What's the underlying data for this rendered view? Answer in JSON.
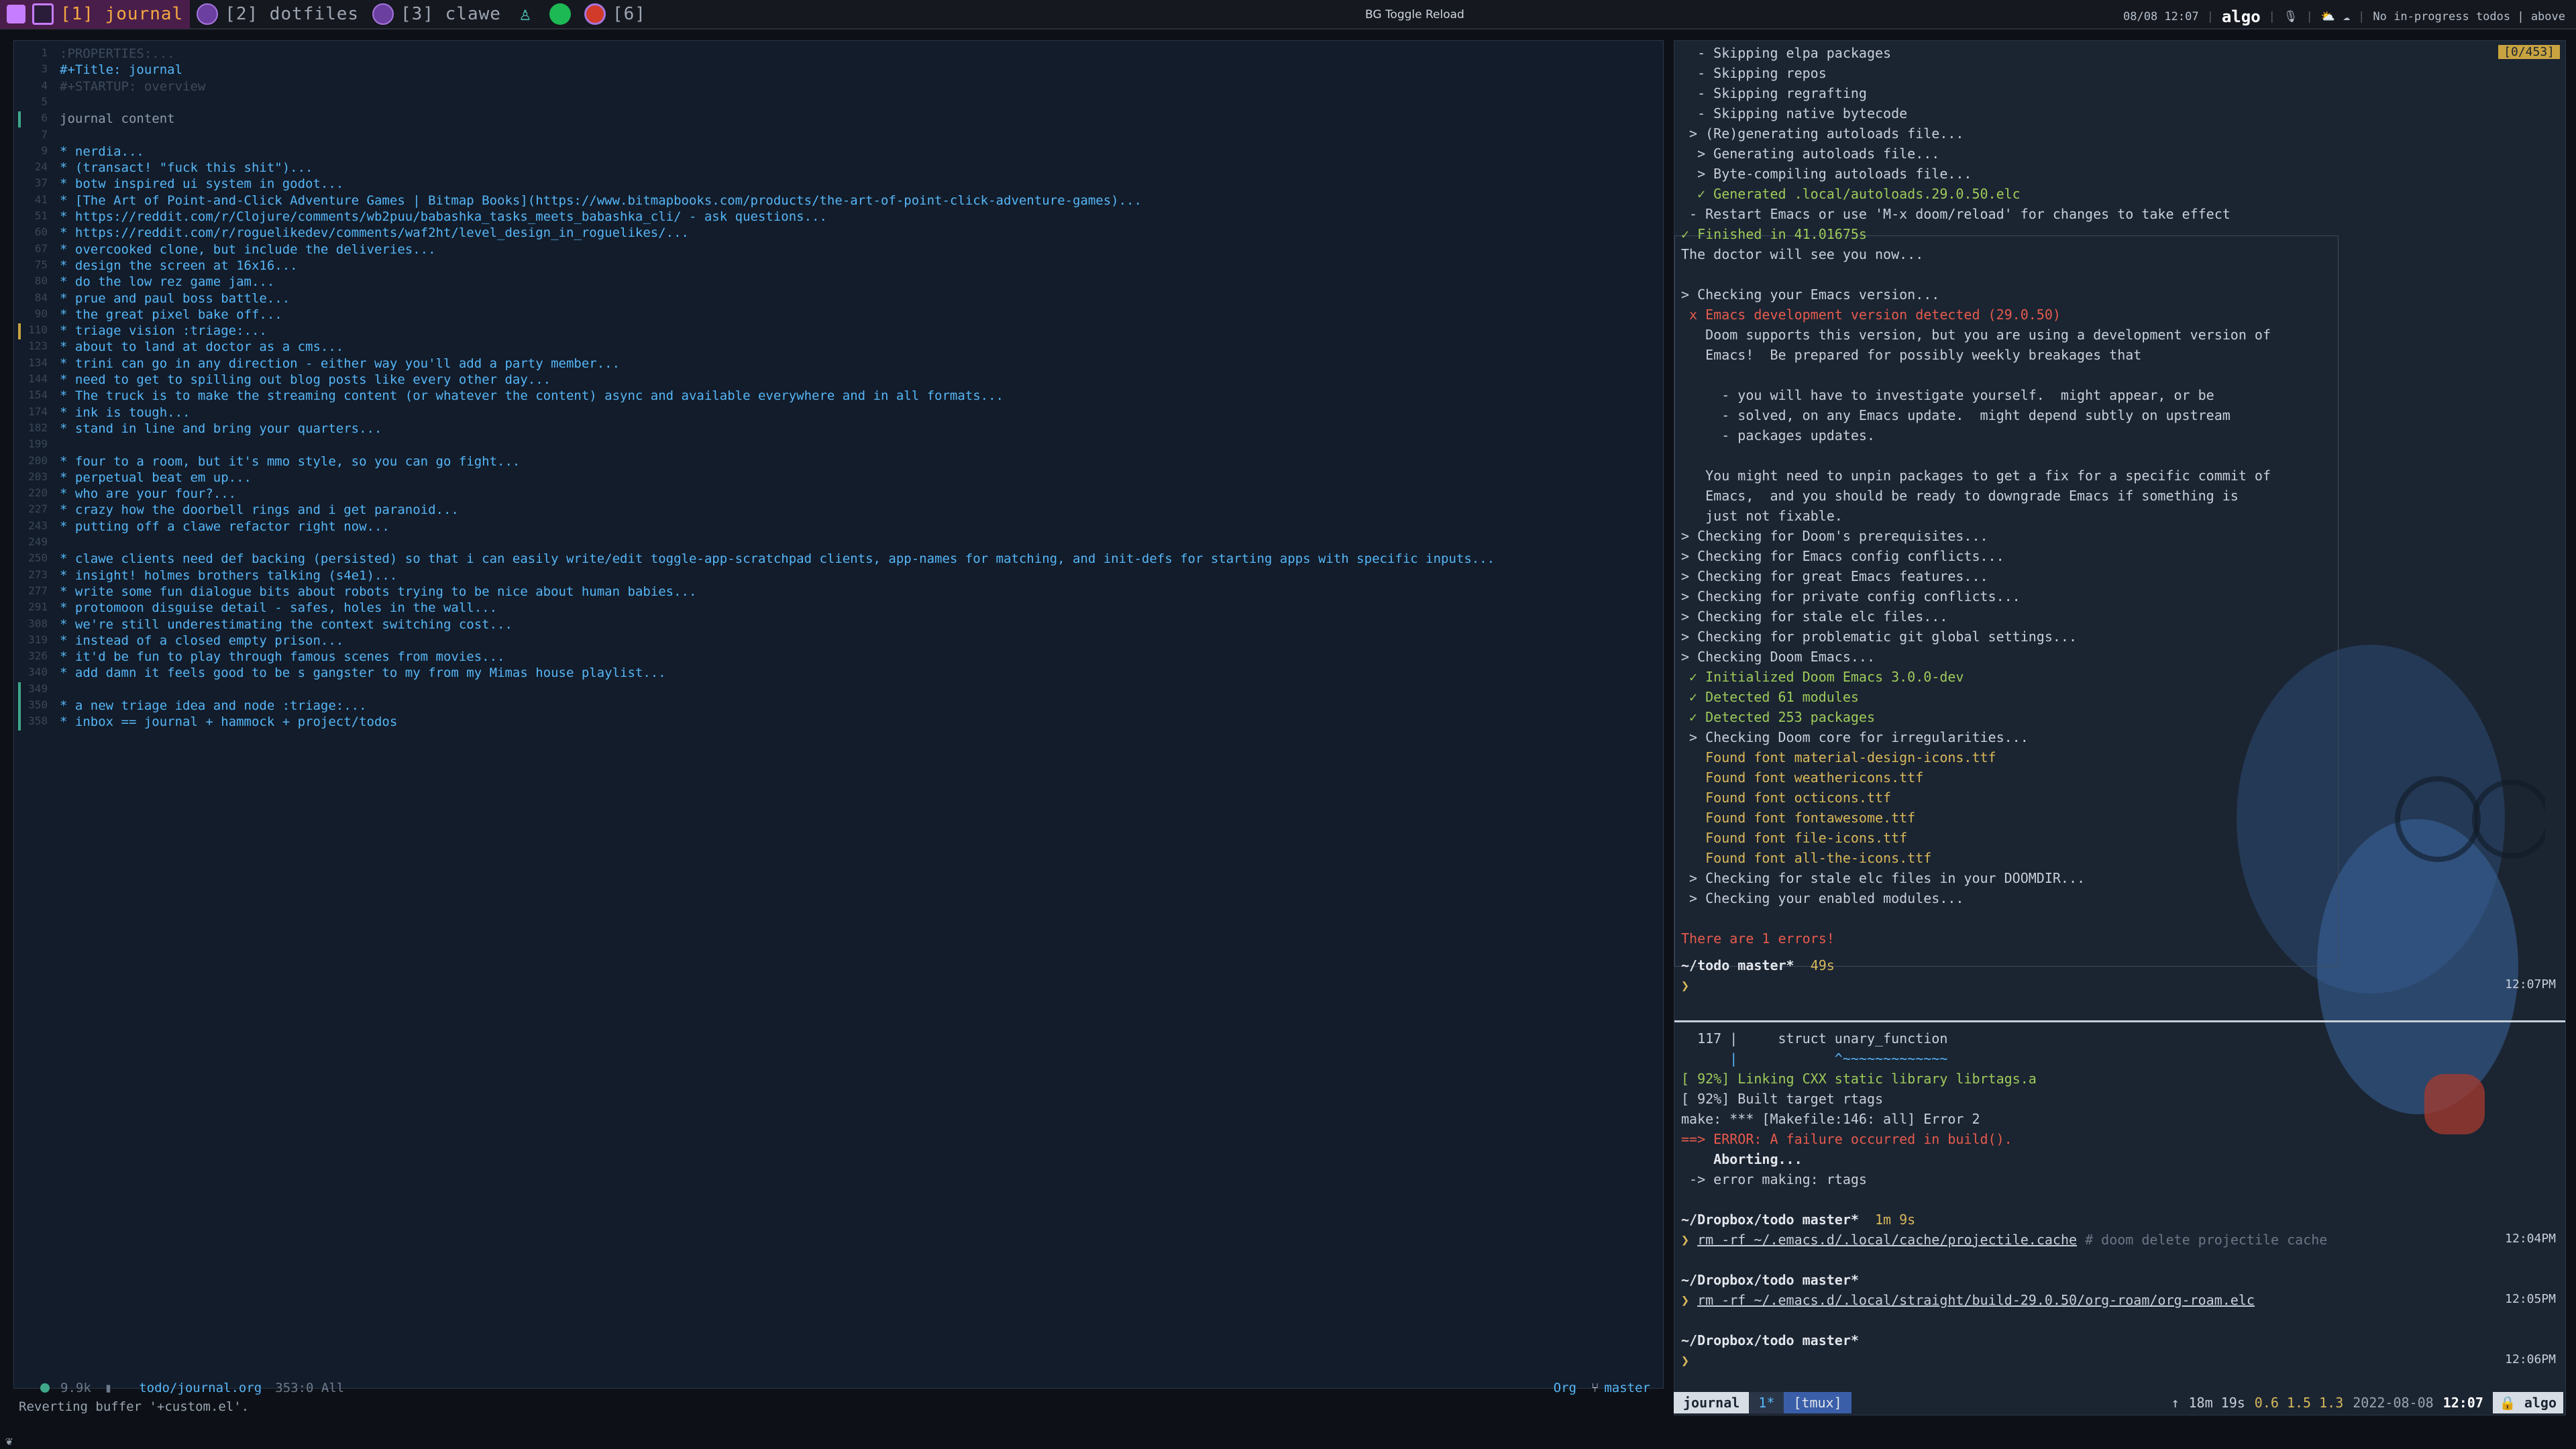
{
  "topbar": {
    "workspaces": [
      {
        "label": "[1] journal",
        "icon": "check-icon",
        "active": true
      },
      {
        "label": "[2] dotfiles",
        "icon": "emacs-icon",
        "active": false
      },
      {
        "label": "[3] clawe",
        "icon": "emacs-icon",
        "active": false
      },
      {
        "label": "",
        "icon": "person-icon",
        "active": false
      },
      {
        "label": "",
        "icon": "spotify-icon",
        "active": false
      },
      {
        "label": "[6]",
        "icon": "firefox-icon",
        "active": false
      }
    ],
    "center_label": "BG Toggle Reload",
    "status": {
      "datetime": "08/08 12:07",
      "host": "algo",
      "todos": "No in-progress todos | above"
    }
  },
  "editor": {
    "lines": [
      {
        "n": "1",
        "t": ":PROPERTIES:...",
        "cls": "dim"
      },
      {
        "n": "3",
        "t": "#+Title: journal",
        "cls": "title"
      },
      {
        "n": "4",
        "t": "#+STARTUP: overview",
        "cls": "dim"
      },
      {
        "n": "5",
        "t": "",
        "cls": "dim"
      },
      {
        "n": "6",
        "t": "journal content",
        "cls": "plain",
        "gutter": "g"
      },
      {
        "n": "7",
        "t": "",
        "cls": "dim"
      },
      {
        "n": "9",
        "t": "* nerdia...",
        "cls": "h"
      },
      {
        "n": "24",
        "t": "* (transact! \"fuck this shit\")...",
        "cls": "h"
      },
      {
        "n": "37",
        "t": "* botw inspired ui system in godot...",
        "cls": "h"
      },
      {
        "n": "41",
        "t": "* [The Art of Point-and-Click Adventure Games | Bitmap Books](https://www.bitmapbooks.com/products/the-art-of-point-click-adventure-games)...",
        "cls": "h"
      },
      {
        "n": "51",
        "t": "* https://reddit.com/r/Clojure/comments/wb2puu/babashka_tasks_meets_babashka_cli/ - ask questions...",
        "cls": "h"
      },
      {
        "n": "60",
        "t": "* https://reddit.com/r/roguelikedev/comments/waf2ht/level_design_in_roguelikes/...",
        "cls": "h"
      },
      {
        "n": "67",
        "t": "* overcooked clone, but include the deliveries...",
        "cls": "h"
      },
      {
        "n": "75",
        "t": "* design the screen at 16x16...",
        "cls": "h"
      },
      {
        "n": "80",
        "t": "* do the low rez game jam...",
        "cls": "h"
      },
      {
        "n": "84",
        "t": "* prue and paul boss battle...",
        "cls": "h"
      },
      {
        "n": "90",
        "t": "* the great pixel bake off...",
        "cls": "h"
      },
      {
        "n": "110",
        "t": "* triage vision :triage:...",
        "cls": "h",
        "gutter": "y"
      },
      {
        "n": "123",
        "t": "* about to land at doctor as a cms...",
        "cls": "h"
      },
      {
        "n": "134",
        "t": "* trini can go in any direction - either way you'll add a party member...",
        "cls": "h"
      },
      {
        "n": "144",
        "t": "* need to get to spilling out blog posts like every other day...",
        "cls": "h"
      },
      {
        "n": "154",
        "t": "* The truck is to make the streaming content (or whatever the content) async and available everywhere and in all formats...",
        "cls": "h"
      },
      {
        "n": "174",
        "t": "* ink is tough...",
        "cls": "h"
      },
      {
        "n": "182",
        "t": "* stand in line and bring your quarters...",
        "cls": "h"
      },
      {
        "n": "199",
        "t": "",
        "cls": "dim"
      },
      {
        "n": "200",
        "t": "* four to a room, but it's mmo style, so you can go fight...",
        "cls": "h"
      },
      {
        "n": "203",
        "t": "* perpetual beat em up...",
        "cls": "h"
      },
      {
        "n": "220",
        "t": "* who are your four?...",
        "cls": "h"
      },
      {
        "n": "227",
        "t": "* crazy how the doorbell rings and i get paranoid...",
        "cls": "h"
      },
      {
        "n": "243",
        "t": "* putting off a clawe refactor right now...",
        "cls": "h"
      },
      {
        "n": "249",
        "t": "",
        "cls": "dim"
      },
      {
        "n": "250",
        "t": "* clawe clients need def backing (persisted) so that i can easily write/edit toggle-app-scratchpad clients, app-names for matching, and init-defs for starting apps with specific inputs...",
        "cls": "h"
      },
      {
        "n": "273",
        "t": "* insight! holmes brothers talking (s4e1)...",
        "cls": "h"
      },
      {
        "n": "277",
        "t": "* write some fun dialogue bits about robots trying to be nice about human babies...",
        "cls": "h"
      },
      {
        "n": "291",
        "t": "* protomoon disguise detail - safes, holes in the wall...",
        "cls": "h"
      },
      {
        "n": "308",
        "t": "* we're still underestimating the context switching cost...",
        "cls": "h"
      },
      {
        "n": "319",
        "t": "* instead of a closed empty prison...",
        "cls": "h"
      },
      {
        "n": "326",
        "t": "* it'd be fun to play through famous scenes from movies...",
        "cls": "h"
      },
      {
        "n": "340",
        "t": "* add damn it feels good to be s gangster to my from my Mimas house playlist...",
        "cls": "h"
      },
      {
        "n": "349",
        "t": "",
        "cls": "dim",
        "gutter": "g"
      },
      {
        "n": "350",
        "t": "* a new triage idea and node :triage:...",
        "cls": "h",
        "gutter": "g"
      },
      {
        "n": "358",
        "t": "* inbox == journal + hammock + project/todos",
        "cls": "h",
        "gutter": "g"
      }
    ]
  },
  "modeline": {
    "size": "9.9k",
    "dir": "todo/",
    "file": "journal.org",
    "pos": "353:0 All",
    "mode": "Org",
    "branch": "master"
  },
  "minibuffer": "Reverting buffer '+custom.el'.",
  "terminal": {
    "counter": "[0/453]",
    "lines": [
      {
        "t": "  - Skipping elpa packages",
        "c": ""
      },
      {
        "t": "  - Skipping repos",
        "c": ""
      },
      {
        "t": "  - Skipping regrafting",
        "c": ""
      },
      {
        "t": "  - Skipping native bytecode",
        "c": ""
      },
      {
        "t": " > (Re)generating autoloads file...",
        "c": ""
      },
      {
        "t": "  > Generating autoloads file...",
        "c": ""
      },
      {
        "t": "  > Byte-compiling autoloads file...",
        "c": ""
      },
      {
        "t": "  ✓ Generated .local/autoloads.29.0.50.elc",
        "c": "g"
      },
      {
        "t": " - Restart Emacs or use 'M-x doom/reload' for changes to take effect",
        "c": ""
      },
      {
        "t": "✓ Finished in 41.01675s",
        "c": "g"
      },
      {
        "t": "The doctor will see you now...",
        "c": ""
      },
      {
        "t": "",
        "c": ""
      },
      {
        "t": "> Checking your Emacs version...",
        "c": ""
      },
      {
        "t": " x Emacs development version detected (29.0.50)",
        "c": "r"
      },
      {
        "t": "   Doom supports this version, but you are using a development version of",
        "c": ""
      },
      {
        "t": "   Emacs!  Be prepared for possibly weekly breakages that",
        "c": ""
      },
      {
        "t": "",
        "c": ""
      },
      {
        "t": "     - you will have to investigate yourself.  might appear, or be",
        "c": ""
      },
      {
        "t": "     - solved, on any Emacs update.  might depend subtly on upstream",
        "c": ""
      },
      {
        "t": "     - packages updates.",
        "c": ""
      },
      {
        "t": "",
        "c": ""
      },
      {
        "t": "   You might need to unpin packages to get a fix for a specific commit of",
        "c": ""
      },
      {
        "t": "   Emacs,  and you should be ready to downgrade Emacs if something is",
        "c": ""
      },
      {
        "t": "   just not fixable.",
        "c": ""
      },
      {
        "t": "> Checking for Doom's prerequisites...",
        "c": ""
      },
      {
        "t": "> Checking for Emacs config conflicts...",
        "c": ""
      },
      {
        "t": "> Checking for great Emacs features...",
        "c": ""
      },
      {
        "t": "> Checking for private config conflicts...",
        "c": ""
      },
      {
        "t": "> Checking for stale elc files...",
        "c": ""
      },
      {
        "t": "> Checking for problematic git global settings...",
        "c": ""
      },
      {
        "t": "> Checking Doom Emacs...",
        "c": ""
      },
      {
        "t": " ✓ Initialized Doom Emacs 3.0.0-dev",
        "c": "g"
      },
      {
        "t": " ✓ Detected 61 modules",
        "c": "g"
      },
      {
        "t": " ✓ Detected 253 packages",
        "c": "g"
      },
      {
        "t": " > Checking Doom core for irregularities...",
        "c": ""
      },
      {
        "t": "   Found font material-design-icons.ttf",
        "c": "y"
      },
      {
        "t": "   Found font weathericons.ttf",
        "c": "y"
      },
      {
        "t": "   Found font octicons.ttf",
        "c": "y"
      },
      {
        "t": "   Found font fontawesome.ttf",
        "c": "y"
      },
      {
        "t": "   Found font file-icons.ttf",
        "c": "y"
      },
      {
        "t": "   Found font all-the-icons.ttf",
        "c": "y"
      },
      {
        "t": " > Checking for stale elc files in your DOOMDIR...",
        "c": ""
      },
      {
        "t": " > Checking your enabled modules...",
        "c": ""
      },
      {
        "t": "",
        "c": ""
      },
      {
        "t": "There are 1 errors!",
        "c": "r"
      }
    ],
    "prompt1": {
      "dir": "~/todo",
      "branch": "master*",
      "dur": "49s",
      "time": "12:07PM"
    },
    "build_lines": [
      {
        "t": "  117 |     struct unary_function",
        "c": ""
      },
      {
        "t": "      |            ^~~~~~~~~~~~~~",
        "c": "c"
      },
      {
        "t": "[ 92%] Linking CXX static library librtags.a",
        "c": "g"
      },
      {
        "t": "[ 92%] Built target rtags",
        "c": ""
      },
      {
        "t": "make: *** [Makefile:146: all] Error 2",
        "c": ""
      },
      {
        "t": "==> ERROR: A failure occurred in build().",
        "c": "r"
      },
      {
        "t": "    Aborting...",
        "c": "b"
      },
      {
        "t": " -> error making: rtags",
        "c": ""
      }
    ],
    "prompts": [
      {
        "dir": "~/Dropbox/todo",
        "branch": "master*",
        "dur": "1m 9s",
        "cmd": "rm -rf ~/.emacs.d/.local/cache/projectile.cache",
        "comment": "# doom delete projectile cache",
        "time": "12:04PM"
      },
      {
        "dir": "~/Dropbox/todo",
        "branch": "master*",
        "dur": "",
        "cmd": "rm -rf ~/.emacs.d/.local/straight/build-29.0.50/org-roam/org-roam.elc",
        "comment": "",
        "time": "12:05PM"
      },
      {
        "dir": "~/Dropbox/todo",
        "branch": "master*",
        "dur": "",
        "cmd": "",
        "comment": "",
        "time": "12:06PM"
      }
    ]
  },
  "tmux": {
    "session": "journal",
    "win1": "1*",
    "win2": "[tmux]",
    "uptime": "18m 19s",
    "load": "0.6 1.5 1.3",
    "date": "2022-08-08",
    "time": "12:07",
    "host": "algo"
  },
  "colors": {
    "accent": "#f4a742",
    "heading": "#56b6f7",
    "ok": "#9ecb5a",
    "error": "#e55b4d",
    "warn": "#d8b85a"
  }
}
